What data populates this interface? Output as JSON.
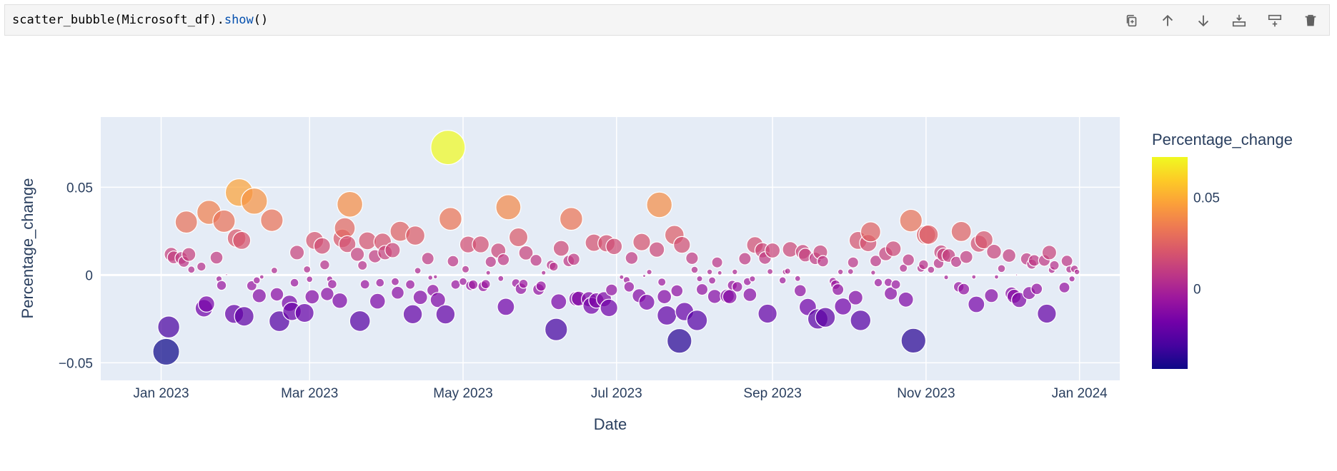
{
  "cell": {
    "code_fn": "scatter_bubble",
    "code_arg": "(Microsoft_df).",
    "code_method": "show",
    "code_tail": "()"
  },
  "toolbar": {
    "icons": [
      "copy-icon",
      "arrow-up-icon",
      "arrow-down-icon",
      "insert-below-icon",
      "insert-above-icon",
      "trash-icon"
    ]
  },
  "colors": {
    "plot_bg": "#e5ecf6",
    "grid": "#ffffff",
    "text": "#2a3f5f"
  },
  "chart_data": {
    "type": "scatter",
    "title": "",
    "xlabel": "Date",
    "ylabel": "Percentage_change",
    "colorbar_title": "Percentage_change",
    "colorscale": "plasma",
    "color_range": [
      -0.044,
      0.072
    ],
    "colorbar_ticks": [
      {
        "value": 0.05,
        "label": "0.05"
      },
      {
        "value": 0,
        "label": "0"
      }
    ],
    "x_range": [
      "2022-12-08",
      "2024-01-17"
    ],
    "y_range": [
      -0.06,
      0.09
    ],
    "x_ticks": [
      {
        "date": "2023-01-01",
        "label": "Jan 2023"
      },
      {
        "date": "2023-03-01",
        "label": "Mar 2023"
      },
      {
        "date": "2023-05-01",
        "label": "May 2023"
      },
      {
        "date": "2023-07-01",
        "label": "Jul 2023"
      },
      {
        "date": "2023-09-01",
        "label": "Sep 2023"
      },
      {
        "date": "2023-11-01",
        "label": "Nov 2023"
      },
      {
        "date": "2024-01-01",
        "label": "Jan 2024"
      }
    ],
    "y_ticks": [
      {
        "value": 0.05,
        "label": "0.05"
      },
      {
        "value": 0,
        "label": "0"
      },
      {
        "value": -0.05,
        "label": "−0.05"
      }
    ],
    "grid": true,
    "legend": "colorbar-right",
    "points": [
      {
        "x": "2023-01-03",
        "y": -0.0437
      },
      {
        "x": "2023-01-04",
        "y": -0.0296
      },
      {
        "x": "2023-01-05",
        "y": 0.0118
      },
      {
        "x": "2023-01-06",
        "y": 0.0101
      },
      {
        "x": "2023-01-09",
        "y": 0.0097
      },
      {
        "x": "2023-01-10",
        "y": 0.0076
      },
      {
        "x": "2023-01-11",
        "y": 0.0302
      },
      {
        "x": "2023-01-12",
        "y": 0.0117
      },
      {
        "x": "2023-01-13",
        "y": 0.0031
      },
      {
        "x": "2023-01-17",
        "y": 0.0048
      },
      {
        "x": "2023-01-18",
        "y": -0.0189
      },
      {
        "x": "2023-01-19",
        "y": -0.0165
      },
      {
        "x": "2023-01-20",
        "y": 0.0357
      },
      {
        "x": "2023-01-23",
        "y": 0.0099
      },
      {
        "x": "2023-01-24",
        "y": -0.0022
      },
      {
        "x": "2023-01-25",
        "y": -0.0059
      },
      {
        "x": "2023-01-26",
        "y": 0.0307
      },
      {
        "x": "2023-01-27",
        "y": 0.0002
      },
      {
        "x": "2023-01-30",
        "y": -0.0221
      },
      {
        "x": "2023-01-31",
        "y": 0.021
      },
      {
        "x": "2023-02-01",
        "y": 0.047
      },
      {
        "x": "2023-02-02",
        "y": 0.0197
      },
      {
        "x": "2023-02-03",
        "y": -0.0235
      },
      {
        "x": "2023-02-06",
        "y": -0.0061
      },
      {
        "x": "2023-02-07",
        "y": 0.0421
      },
      {
        "x": "2023-02-08",
        "y": -0.003
      },
      {
        "x": "2023-02-09",
        "y": -0.0118
      },
      {
        "x": "2023-02-10",
        "y": -0.0011
      },
      {
        "x": "2023-02-14",
        "y": 0.0312
      },
      {
        "x": "2023-02-15",
        "y": 0.0026
      },
      {
        "x": "2023-02-16",
        "y": -0.011
      },
      {
        "x": "2023-02-17",
        "y": -0.0263
      },
      {
        "x": "2023-02-21",
        "y": -0.0161
      },
      {
        "x": "2023-02-22",
        "y": -0.0207
      },
      {
        "x": "2023-02-23",
        "y": -0.0044
      },
      {
        "x": "2023-02-24",
        "y": 0.0128
      },
      {
        "x": "2023-02-27",
        "y": -0.0216
      },
      {
        "x": "2023-02-28",
        "y": 0.0032
      },
      {
        "x": "2023-03-01",
        "y": -0.0024
      },
      {
        "x": "2023-03-02",
        "y": -0.0124
      },
      {
        "x": "2023-03-03",
        "y": 0.0197
      },
      {
        "x": "2023-03-06",
        "y": 0.0166
      },
      {
        "x": "2023-03-07",
        "y": 0.0058
      },
      {
        "x": "2023-03-08",
        "y": -0.0108
      },
      {
        "x": "2023-03-09",
        "y": -0.0023
      },
      {
        "x": "2023-03-10",
        "y": -0.0052
      },
      {
        "x": "2023-03-13",
        "y": -0.0146
      },
      {
        "x": "2023-03-14",
        "y": 0.0209
      },
      {
        "x": "2023-03-15",
        "y": 0.0267
      },
      {
        "x": "2023-03-16",
        "y": 0.0176
      },
      {
        "x": "2023-03-17",
        "y": 0.0403
      },
      {
        "x": "2023-03-20",
        "y": 0.0118
      },
      {
        "x": "2023-03-21",
        "y": -0.0262
      },
      {
        "x": "2023-03-22",
        "y": 0.0055
      },
      {
        "x": "2023-03-23",
        "y": -0.0053
      },
      {
        "x": "2023-03-24",
        "y": 0.0195
      },
      {
        "x": "2023-03-27",
        "y": 0.0107
      },
      {
        "x": "2023-03-28",
        "y": -0.0149
      },
      {
        "x": "2023-03-29",
        "y": -0.0044
      },
      {
        "x": "2023-03-30",
        "y": 0.0189
      },
      {
        "x": "2023-03-31",
        "y": 0.0128
      },
      {
        "x": "2023-04-03",
        "y": 0.0142
      },
      {
        "x": "2023-04-04",
        "y": -0.0038
      },
      {
        "x": "2023-04-05",
        "y": -0.0101
      },
      {
        "x": "2023-04-06",
        "y": 0.0249
      },
      {
        "x": "2023-04-10",
        "y": -0.0054
      },
      {
        "x": "2023-04-11",
        "y": -0.0223
      },
      {
        "x": "2023-04-12",
        "y": 0.0225
      },
      {
        "x": "2023-04-13",
        "y": 0.0025
      },
      {
        "x": "2023-04-14",
        "y": -0.0127
      },
      {
        "x": "2023-04-17",
        "y": 0.0094
      },
      {
        "x": "2023-04-18",
        "y": -0.0015
      },
      {
        "x": "2023-04-19",
        "y": -0.0087
      },
      {
        "x": "2023-04-20",
        "y": -0.001
      },
      {
        "x": "2023-04-21",
        "y": -0.0142
      },
      {
        "x": "2023-04-24",
        "y": -0.0224
      },
      {
        "x": "2023-04-25",
        "y": 0.0727
      },
      {
        "x": "2023-04-26",
        "y": 0.032
      },
      {
        "x": "2023-04-27",
        "y": 0.0079
      },
      {
        "x": "2023-04-28",
        "y": -0.0054
      },
      {
        "x": "2023-05-01",
        "y": -0.0037
      },
      {
        "x": "2023-05-02",
        "y": 0.0033
      },
      {
        "x": "2023-05-03",
        "y": 0.0174
      },
      {
        "x": "2023-05-04",
        "y": -0.006
      },
      {
        "x": "2023-05-05",
        "y": -0.0055
      },
      {
        "x": "2023-05-08",
        "y": 0.0175
      },
      {
        "x": "2023-05-09",
        "y": -0.0065
      },
      {
        "x": "2023-05-10",
        "y": -0.0052
      },
      {
        "x": "2023-05-11",
        "y": 0.0013
      },
      {
        "x": "2023-05-12",
        "y": 0.0075
      },
      {
        "x": "2023-05-15",
        "y": 0.0139
      },
      {
        "x": "2023-05-16",
        "y": -0.002
      },
      {
        "x": "2023-05-17",
        "y": 0.0088
      },
      {
        "x": "2023-05-18",
        "y": -0.0181
      },
      {
        "x": "2023-05-19",
        "y": 0.0386
      },
      {
        "x": "2023-05-22",
        "y": -0.0046
      },
      {
        "x": "2023-05-23",
        "y": 0.0215
      },
      {
        "x": "2023-05-24",
        "y": -0.0078
      },
      {
        "x": "2023-05-25",
        "y": -0.005
      },
      {
        "x": "2023-05-26",
        "y": 0.0126
      },
      {
        "x": "2023-05-30",
        "y": 0.0084
      },
      {
        "x": "2023-05-31",
        "y": -0.0082
      },
      {
        "x": "2023-06-01",
        "y": -0.0063
      },
      {
        "x": "2023-06-02",
        "y": 0.0013
      },
      {
        "x": "2023-06-05",
        "y": 0.0057
      },
      {
        "x": "2023-06-06",
        "y": 0.0048
      },
      {
        "x": "2023-06-07",
        "y": -0.031
      },
      {
        "x": "2023-06-08",
        "y": -0.0152
      },
      {
        "x": "2023-06-09",
        "y": 0.0152
      },
      {
        "x": "2023-06-12",
        "y": 0.008
      },
      {
        "x": "2023-06-13",
        "y": 0.032
      },
      {
        "x": "2023-06-14",
        "y": 0.009
      },
      {
        "x": "2023-06-15",
        "y": -0.0135
      },
      {
        "x": "2023-06-16",
        "y": -0.0134
      },
      {
        "x": "2023-06-20",
        "y": -0.0138
      },
      {
        "x": "2023-06-21",
        "y": -0.0175
      },
      {
        "x": "2023-06-22",
        "y": 0.0184
      },
      {
        "x": "2023-06-23",
        "y": -0.0145
      },
      {
        "x": "2023-06-26",
        "y": -0.0138
      },
      {
        "x": "2023-06-27",
        "y": 0.0181
      },
      {
        "x": "2023-06-28",
        "y": -0.0187
      },
      {
        "x": "2023-06-29",
        "y": -0.0085
      },
      {
        "x": "2023-06-30",
        "y": 0.0163
      },
      {
        "x": "2023-07-03",
        "y": -0.0012
      },
      {
        "x": "2023-07-05",
        "y": -0.0028
      },
      {
        "x": "2023-07-06",
        "y": -0.0067
      },
      {
        "x": "2023-07-07",
        "y": 0.0097
      },
      {
        "x": "2023-07-10",
        "y": -0.0118
      },
      {
        "x": "2023-07-11",
        "y": 0.0188
      },
      {
        "x": "2023-07-12",
        "y": -0.0005
      },
      {
        "x": "2023-07-13",
        "y": -0.0155
      },
      {
        "x": "2023-07-14",
        "y": 0.0017
      },
      {
        "x": "2023-07-17",
        "y": 0.0145
      },
      {
        "x": "2023-07-18",
        "y": 0.04
      },
      {
        "x": "2023-07-19",
        "y": -0.004
      },
      {
        "x": "2023-07-20",
        "y": -0.0123
      },
      {
        "x": "2023-07-21",
        "y": -0.023
      },
      {
        "x": "2023-07-24",
        "y": 0.0228
      },
      {
        "x": "2023-07-25",
        "y": -0.009
      },
      {
        "x": "2023-07-26",
        "y": -0.0375
      },
      {
        "x": "2023-07-27",
        "y": 0.0172
      },
      {
        "x": "2023-07-28",
        "y": -0.0208
      },
      {
        "x": "2023-07-31",
        "y": 0.0096
      },
      {
        "x": "2023-08-01",
        "y": 0.003
      },
      {
        "x": "2023-08-02",
        "y": -0.0258
      },
      {
        "x": "2023-08-03",
        "y": -0.0021
      },
      {
        "x": "2023-08-04",
        "y": -0.0082
      },
      {
        "x": "2023-08-07",
        "y": 0.0018
      },
      {
        "x": "2023-08-08",
        "y": -0.0031
      },
      {
        "x": "2023-08-09",
        "y": -0.0122
      },
      {
        "x": "2023-08-10",
        "y": 0.0072
      },
      {
        "x": "2023-08-11",
        "y": 0.0012
      },
      {
        "x": "2023-08-14",
        "y": -0.012
      },
      {
        "x": "2023-08-15",
        "y": -0.0123
      },
      {
        "x": "2023-08-16",
        "y": -0.0058
      },
      {
        "x": "2023-08-17",
        "y": 0.0018
      },
      {
        "x": "2023-08-18",
        "y": -0.0067
      },
      {
        "x": "2023-08-21",
        "y": 0.0093
      },
      {
        "x": "2023-08-22",
        "y": -0.0038
      },
      {
        "x": "2023-08-23",
        "y": -0.0112
      },
      {
        "x": "2023-08-24",
        "y": -0.0022
      },
      {
        "x": "2023-08-25",
        "y": 0.0171
      },
      {
        "x": "2023-08-28",
        "y": 0.0141
      },
      {
        "x": "2023-08-29",
        "y": 0.0097
      },
      {
        "x": "2023-08-30",
        "y": -0.022
      },
      {
        "x": "2023-08-31",
        "y": 0.002
      },
      {
        "x": "2023-09-01",
        "y": 0.014
      },
      {
        "x": "2023-09-05",
        "y": -0.003
      },
      {
        "x": "2023-09-06",
        "y": 0.0018
      },
      {
        "x": "2023-09-07",
        "y": 0.0022
      },
      {
        "x": "2023-09-08",
        "y": 0.0146
      },
      {
        "x": "2023-09-11",
        "y": -0.002
      },
      {
        "x": "2023-09-12",
        "y": -0.0089
      },
      {
        "x": "2023-09-13",
        "y": 0.0132
      },
      {
        "x": "2023-09-14",
        "y": 0.0114
      },
      {
        "x": "2023-09-15",
        "y": -0.0182
      },
      {
        "x": "2023-09-18",
        "y": 0.0095
      },
      {
        "x": "2023-09-19",
        "y": -0.025
      },
      {
        "x": "2023-09-20",
        "y": 0.013
      },
      {
        "x": "2023-09-21",
        "y": 0.0079
      },
      {
        "x": "2023-09-22",
        "y": -0.0241
      },
      {
        "x": "2023-09-25",
        "y": -0.0035
      },
      {
        "x": "2023-09-26",
        "y": -0.0055
      },
      {
        "x": "2023-09-27",
        "y": -0.0083
      },
      {
        "x": "2023-09-28",
        "y": 0.0018
      },
      {
        "x": "2023-09-29",
        "y": -0.0179
      },
      {
        "x": "2023-10-02",
        "y": 0.002
      },
      {
        "x": "2023-10-03",
        "y": 0.0072
      },
      {
        "x": "2023-10-04",
        "y": -0.0129
      },
      {
        "x": "2023-10-05",
        "y": 0.0197
      },
      {
        "x": "2023-10-06",
        "y": -0.0258
      },
      {
        "x": "2023-10-09",
        "y": 0.0182
      },
      {
        "x": "2023-10-10",
        "y": 0.0246
      },
      {
        "x": "2023-10-11",
        "y": 0.0014
      },
      {
        "x": "2023-10-12",
        "y": 0.008
      },
      {
        "x": "2023-10-13",
        "y": -0.0043
      },
      {
        "x": "2023-10-16",
        "y": 0.0121
      },
      {
        "x": "2023-10-17",
        "y": -0.0042
      },
      {
        "x": "2023-10-18",
        "y": -0.0105
      },
      {
        "x": "2023-10-19",
        "y": 0.015
      },
      {
        "x": "2023-10-20",
        "y": -0.0054
      },
      {
        "x": "2023-10-23",
        "y": 0.0039
      },
      {
        "x": "2023-10-24",
        "y": -0.014
      },
      {
        "x": "2023-10-25",
        "y": 0.0086
      },
      {
        "x": "2023-10-26",
        "y": 0.031
      },
      {
        "x": "2023-10-27",
        "y": -0.0374
      },
      {
        "x": "2023-10-30",
        "y": 0.0039
      },
      {
        "x": "2023-10-31",
        "y": 0.0059
      },
      {
        "x": "2023-11-01",
        "y": 0.0229
      },
      {
        "x": "2023-11-02",
        "y": 0.023
      },
      {
        "x": "2023-11-03",
        "y": 0.003
      },
      {
        "x": "2023-11-06",
        "y": 0.0067
      },
      {
        "x": "2023-11-07",
        "y": 0.013
      },
      {
        "x": "2023-11-08",
        "y": 0.0115
      },
      {
        "x": "2023-11-09",
        "y": -0.0013
      },
      {
        "x": "2023-11-10",
        "y": 0.0111
      },
      {
        "x": "2023-11-13",
        "y": 0.0075
      },
      {
        "x": "2023-11-14",
        "y": -0.0067
      },
      {
        "x": "2023-11-15",
        "y": 0.0248
      },
      {
        "x": "2023-11-16",
        "y": -0.008
      },
      {
        "x": "2023-11-17",
        "y": 0.0103
      },
      {
        "x": "2023-11-20",
        "y": -0.0011
      },
      {
        "x": "2023-11-21",
        "y": -0.0167
      },
      {
        "x": "2023-11-22",
        "y": 0.0179
      },
      {
        "x": "2023-11-24",
        "y": 0.0201
      },
      {
        "x": "2023-11-27",
        "y": -0.0117
      },
      {
        "x": "2023-11-28",
        "y": 0.0133
      },
      {
        "x": "2023-11-29",
        "y": -0.0011
      },
      {
        "x": "2023-12-01",
        "y": 0.0037
      },
      {
        "x": "2023-12-04",
        "y": 0.0111
      },
      {
        "x": "2023-12-05",
        "y": -0.0105
      },
      {
        "x": "2023-12-06",
        "y": -0.0121
      },
      {
        "x": "2023-12-07",
        "y": 0.0001
      },
      {
        "x": "2023-12-08",
        "y": -0.0142
      },
      {
        "x": "2023-12-11",
        "y": 0.0092
      },
      {
        "x": "2023-12-12",
        "y": -0.0103
      },
      {
        "x": "2023-12-13",
        "y": 0.0062
      },
      {
        "x": "2023-12-14",
        "y": 0.0083
      },
      {
        "x": "2023-12-15",
        "y": -0.0079
      },
      {
        "x": "2023-12-18",
        "y": 0.0083
      },
      {
        "x": "2023-12-19",
        "y": -0.022
      },
      {
        "x": "2023-12-20",
        "y": 0.0128
      },
      {
        "x": "2023-12-21",
        "y": 0.0029
      },
      {
        "x": "2023-12-22",
        "y": 0.0055
      },
      {
        "x": "2023-12-26",
        "y": -0.0071
      },
      {
        "x": "2023-12-27",
        "y": 0.008
      },
      {
        "x": "2023-12-28",
        "y": 0.0032
      },
      {
        "x": "2023-12-29",
        "y": -0.0022
      },
      {
        "x": "2023-12-30",
        "y": 0.0035
      },
      {
        "x": "2023-12-31",
        "y": 0.0018
      }
    ]
  }
}
